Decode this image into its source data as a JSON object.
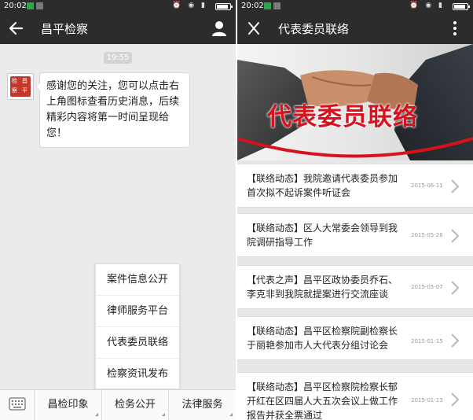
{
  "left_screen": {
    "status": {
      "time": "20:02"
    },
    "title": "昌平检察",
    "chat": {
      "time": "19:55",
      "avatar_chars": [
        "检",
        "昌",
        "察",
        "平"
      ],
      "message": "感谢您的关注，您可以点击右上角图标查看历史消息，后续精彩内容将第一时间呈现给您！"
    },
    "popup_menu": [
      "案件信息公开",
      "律师服务平台",
      "代表委员联络",
      "检察资讯发布"
    ],
    "bottom_menu": [
      "昌检印象",
      "检务公开",
      "法律服务"
    ]
  },
  "right_screen": {
    "status": {
      "time": "20:02"
    },
    "title": "代表委员联络",
    "banner": {
      "title": "代表委员联络"
    },
    "articles": [
      {
        "title": "【联络动态】我院邀请代表委员参加首次拟不起诉案件听证会",
        "date": "2015-06-11"
      },
      {
        "title": "【联络动态】区人大常委会领导到我院调研指导工作",
        "date": "2015-05-26"
      },
      {
        "title": "【代表之声】昌平区政协委员乔石、李克非到我院就提案进行交流座谈",
        "date": "2015-05-07"
      },
      {
        "title": "【联络动态】昌平区检察院副检察长于丽艳参加市人大代表分组讨论会",
        "date": "2015-01-15"
      },
      {
        "title": "【联络动态】昌平区检察院检察长郁开红在区四届人大五次会议上做工作报告并获全票通过",
        "date": "2015-01-13"
      }
    ]
  },
  "colors": {
    "topbar": "#2c2c2c",
    "banner_text": "#d7121d",
    "chat_bg": "#ebebeb"
  }
}
